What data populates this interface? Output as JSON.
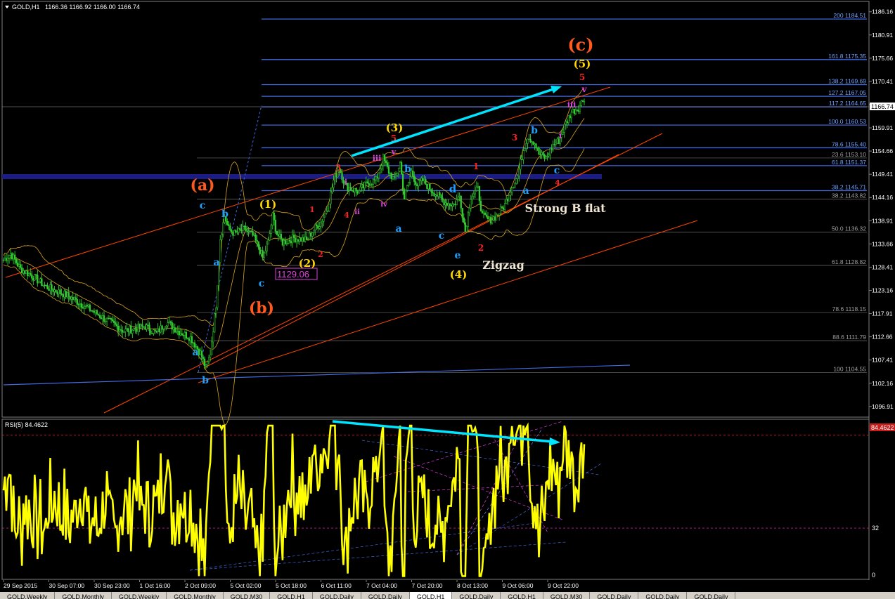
{
  "window": {
    "symbol_title": "GOLD,H1",
    "ohlc": "1166.36 1166.92 1166.00 1166.74",
    "current_price": "1166.74",
    "rsi_title": "RSI(5) 84.4622",
    "rsi_current": "84.4622",
    "rsi_level_label": "32",
    "rsi_zero_label": "0"
  },
  "colors": {
    "background": "#000000",
    "candles": "#32cd32",
    "bands": "#daa520",
    "fib_lines": "#4169e1",
    "trend_lines": "#ff4500",
    "rsi_line": "#ffff00",
    "arrow": "#00e5ff",
    "wave_c_orange": "#ff5a1e",
    "wave_yellow": "#ffd700",
    "wave_blue": "#1ea0ff",
    "wave_red": "#ff2020",
    "wave_magenta": "#e040e0"
  },
  "chart_data": {
    "type": "candlestick",
    "symbol": "GOLD",
    "timeframe": "H1",
    "ylim": [
      1094.5,
      1188.5
    ],
    "price_ticks": [
      "1186.16",
      "1180.91",
      "1175.66",
      "1170.41",
      "1165.16",
      "1159.91",
      "1154.66",
      "1149.41",
      "1144.16",
      "1138.91",
      "1133.66",
      "1128.41",
      "1123.16",
      "1117.91",
      "1112.66",
      "1107.41",
      "1102.16",
      "1096.91"
    ],
    "x_labels": [
      "29 Sep 2015",
      "30 Sep 07:00",
      "30 Sep 23:00",
      "1 Oct 16:00",
      "2 Oct 09:00",
      "5 Oct 02:00",
      "5 Oct 18:00",
      "6 Oct 11:00",
      "7 Oct 04:00",
      "7 Oct 20:00",
      "8 Oct 13:00",
      "9 Oct 06:00",
      "9 Oct 22:00"
    ],
    "price_path": [
      [
        0,
        1130
      ],
      [
        5,
        1131.5
      ],
      [
        12,
        1128
      ],
      [
        20,
        1126.5
      ],
      [
        30,
        1124
      ],
      [
        45,
        1122
      ],
      [
        58,
        1119.5
      ],
      [
        70,
        1117
      ],
      [
        85,
        1114
      ],
      [
        100,
        1115
      ],
      [
        108,
        1113.5
      ],
      [
        115,
        1116
      ],
      [
        123,
        1114
      ],
      [
        132,
        1112.5
      ],
      [
        139,
        1109
      ],
      [
        143,
        1105.5
      ],
      [
        146,
        1109
      ],
      [
        150,
        1120
      ],
      [
        153,
        1135
      ],
      [
        156,
        1140
      ],
      [
        159,
        1137
      ],
      [
        163,
        1136
      ],
      [
        170,
        1137
      ],
      [
        176,
        1135.5
      ],
      [
        180,
        1133
      ],
      [
        183,
        1130.5
      ],
      [
        187,
        1134
      ],
      [
        190,
        1140
      ],
      [
        193,
        1136
      ],
      [
        197,
        1134
      ],
      [
        205,
        1135
      ],
      [
        214,
        1134.5
      ],
      [
        219,
        1137
      ],
      [
        224,
        1138.5
      ],
      [
        229,
        1142
      ],
      [
        233,
        1148
      ],
      [
        237,
        1151
      ],
      [
        241,
        1147
      ],
      [
        246,
        1146
      ],
      [
        251,
        1145.5
      ],
      [
        257,
        1147.5
      ],
      [
        263,
        1148
      ],
      [
        268,
        1153
      ],
      [
        272,
        1150
      ],
      [
        276,
        1148
      ],
      [
        280,
        1152
      ],
      [
        283,
        1144
      ],
      [
        288,
        1150
      ],
      [
        292,
        1147
      ],
      [
        296,
        1148
      ],
      [
        300,
        1146.5
      ],
      [
        305,
        1145
      ],
      [
        312,
        1143
      ],
      [
        318,
        1142.5
      ],
      [
        322,
        1144.5
      ],
      [
        326,
        1136.5
      ],
      [
        330,
        1144.5
      ],
      [
        335,
        1146
      ],
      [
        338,
        1140
      ],
      [
        343,
        1139
      ],
      [
        348,
        1140
      ],
      [
        354,
        1142.5
      ],
      [
        358,
        1146
      ],
      [
        363,
        1149
      ],
      [
        367,
        1155
      ],
      [
        370,
        1158
      ],
      [
        375,
        1156.5
      ],
      [
        378,
        1154
      ],
      [
        383,
        1153
      ],
      [
        388,
        1156
      ],
      [
        392,
        1157
      ],
      [
        397,
        1161
      ],
      [
        401,
        1163.5
      ],
      [
        406,
        1164.5
      ],
      [
        410,
        1166.74
      ]
    ],
    "bar_count": 411,
    "fibonacci": [
      {
        "ratio": "200",
        "price": "1184.51"
      },
      {
        "ratio": "161.8",
        "price": "1175.35"
      },
      {
        "ratio": "138.2",
        "price": "1169.69"
      },
      {
        "ratio": "127.2",
        "price": "1167.05"
      },
      {
        "ratio": "117.2",
        "price": "1164.65"
      },
      {
        "ratio": "100.0",
        "price": "1160.53"
      },
      {
        "ratio": "78.6",
        "price": "1155.40"
      },
      {
        "ratio": "23.6",
        "price": "1153.10"
      },
      {
        "ratio": "61.8",
        "price": "1151.37"
      },
      {
        "ratio": "38.2",
        "price": "1145.71"
      },
      {
        "ratio": "38.2",
        "price": "1143.82"
      },
      {
        "ratio": "50.0",
        "price": "1136.32"
      },
      {
        "ratio": "61.8",
        "price": "1128.82"
      },
      {
        "ratio": "78.6",
        "price": "1118.15"
      },
      {
        "ratio": "88.6",
        "price": "1111.79"
      },
      {
        "ratio": "100",
        "price": "1104.55"
      }
    ],
    "price_box_label": "1129.06",
    "wave_labels": [
      {
        "text": "(c)",
        "color": "orange"
      },
      {
        "text": "(a)",
        "color": "orange"
      },
      {
        "text": "(b)",
        "color": "orange"
      },
      {
        "text": "(5)",
        "color": "yellow"
      },
      {
        "text": "(3)",
        "color": "yellow"
      },
      {
        "text": "(1)",
        "color": "yellow"
      },
      {
        "text": "(2)",
        "color": "yellow"
      },
      {
        "text": "(4)",
        "color": "yellow"
      },
      {
        "text": "5",
        "color": "red"
      },
      {
        "text": "v",
        "color": "magenta"
      },
      {
        "text": "iii",
        "color": "magenta"
      },
      {
        "text": "3",
        "color": "red"
      },
      {
        "text": "b",
        "color": "blue"
      },
      {
        "text": "i",
        "color": "magenta"
      },
      {
        "text": "a",
        "color": "blue"
      },
      {
        "text": "c",
        "color": "blue"
      },
      {
        "text": "4",
        "color": "red"
      },
      {
        "text": "1",
        "color": "red"
      },
      {
        "text": "d",
        "color": "blue"
      },
      {
        "text": "e",
        "color": "blue"
      },
      {
        "text": "2",
        "color": "red"
      },
      {
        "text": "Strong B flat",
        "color": "white"
      },
      {
        "text": "Zigzag",
        "color": "white"
      }
    ],
    "rsi": {
      "period": 5,
      "current": 84.4622,
      "level": 32,
      "ylim": [
        0,
        100
      ]
    }
  },
  "tabs": [
    "GOLD,Weekly",
    "GOLD,Monthly",
    "GOLD,Weekly",
    "GOLD,Monthly",
    "GOLD,M30",
    "GOLD,H1",
    "GOLD,Daily",
    "GOLD,Daily",
    "GOLD,H1",
    "GOLD,Daily",
    "GOLD,H1",
    "GOLD,M30",
    "GOLD,Daily",
    "GOLD,Daily",
    "GOLD,Daily"
  ],
  "active_tab_index": 8
}
